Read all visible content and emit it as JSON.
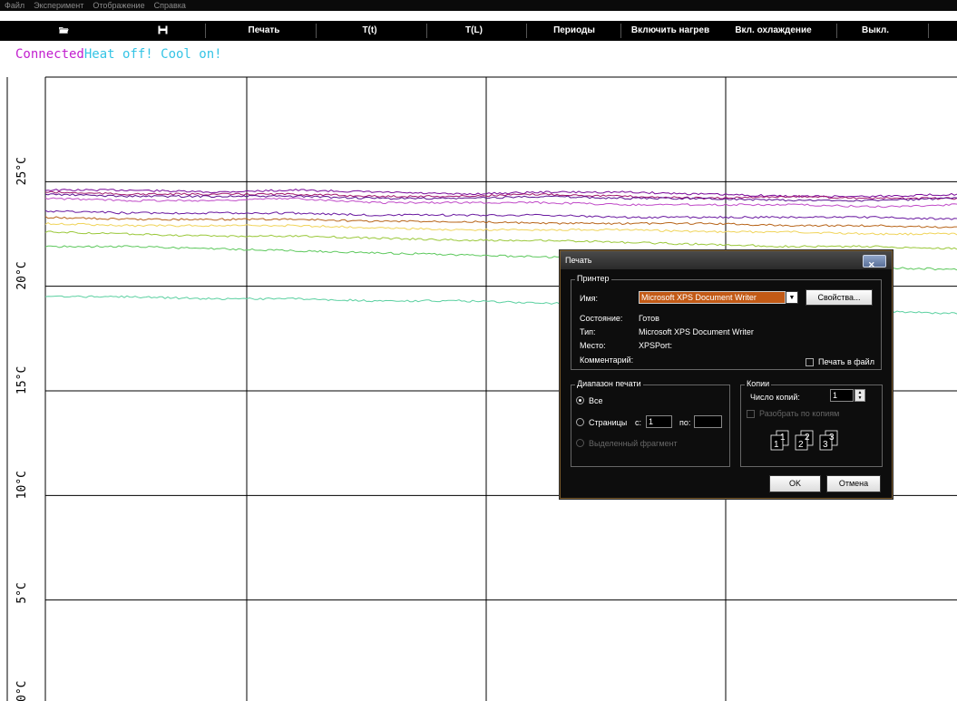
{
  "menu": [
    "Файл",
    "Эксперимент",
    "Отображение",
    "Справка"
  ],
  "toolbar": {
    "open_icon": "folder-open-icon",
    "save_icon": "floppy-save-icon",
    "print": "Печать",
    "t_time": "T(t)",
    "t_length": "T(L)",
    "periods": "Периоды",
    "heat_on": "Включить нагрев",
    "cool_on": "Вкл. охлаждение",
    "off": "Выкл."
  },
  "status": {
    "connected": "Connected",
    "heat_cool": "Heat off! Cool on!",
    "connected_color": "#c21fcf",
    "heat_color": "#35c4e5"
  },
  "chart_data": {
    "type": "line",
    "ylabels": [
      "25°C",
      "20°C",
      "15°C",
      "10°C",
      "5°C",
      "0°C"
    ],
    "y_ticks": [
      25,
      20,
      15,
      10,
      5,
      0
    ],
    "ylim": [
      0,
      30
    ],
    "grid": true,
    "series": [
      {
        "color": "#7a0a9a",
        "values": [
          24.6,
          24.6,
          24.5,
          24.6,
          24.5,
          24.4,
          24.5,
          24.5,
          24.4,
          24.3,
          24.3,
          24.4
        ]
      },
      {
        "color": "#a0186e",
        "values": [
          24.5,
          24.4,
          24.4,
          24.4,
          24.3,
          24.3,
          24.4,
          24.3,
          24.2,
          24.3,
          24.2,
          24.2
        ]
      },
      {
        "color": "#5a0f8f",
        "values": [
          24.4,
          24.3,
          24.3,
          24.3,
          24.2,
          24.2,
          24.3,
          24.2,
          24.2,
          24.1,
          24.1,
          24.2
        ]
      },
      {
        "color": "#c04bc8",
        "values": [
          24.2,
          24.1,
          24.1,
          24.2,
          24.0,
          24.0,
          24.0,
          23.9,
          23.9,
          23.9,
          23.8,
          23.9
        ]
      },
      {
        "color": "#6a1aa0",
        "values": [
          23.6,
          23.5,
          23.5,
          23.5,
          23.4,
          23.4,
          23.4,
          23.3,
          23.3,
          23.3,
          23.3,
          23.2
        ]
      },
      {
        "color": "#b8651a",
        "values": [
          23.3,
          23.2,
          23.2,
          23.2,
          23.1,
          23.1,
          23.0,
          23.0,
          23.0,
          22.9,
          22.9,
          22.8
        ]
      },
      {
        "color": "#f0d45a",
        "values": [
          23.0,
          22.9,
          22.9,
          22.9,
          22.8,
          22.7,
          22.7,
          22.7,
          22.6,
          22.6,
          22.5,
          22.5
        ]
      },
      {
        "color": "#9ac83a",
        "values": [
          22.6,
          22.5,
          22.4,
          22.4,
          22.3,
          22.2,
          22.2,
          22.1,
          22.0,
          21.9,
          21.9,
          21.8
        ]
      },
      {
        "color": "#5cc85c",
        "values": [
          21.9,
          21.9,
          21.8,
          21.7,
          21.6,
          21.5,
          21.4,
          21.3,
          21.2,
          21.1,
          20.9,
          20.8
        ]
      },
      {
        "color": "#5ad0a0",
        "values": [
          19.5,
          19.5,
          19.4,
          19.4,
          19.3,
          19.3,
          19.2,
          19.1,
          19.0,
          18.9,
          18.8,
          18.7
        ]
      }
    ]
  },
  "dialog": {
    "title": "Печать",
    "printer_group": "Принтер",
    "name_label": "Имя:",
    "name_value": "Microsoft XPS Document Writer",
    "properties_btn": "Свойства...",
    "state_label": "Состояние:",
    "state_value": "Готов",
    "type_label": "Тип:",
    "type_value": "Microsoft XPS Document Writer",
    "place_label": "Место:",
    "place_value": "XPSPort:",
    "comment_label": "Комментарий:",
    "print_to_file": "Печать в файл",
    "range_group": "Диапазон печати",
    "all": "Все",
    "pages": "Страницы",
    "from_label": "с:",
    "from_value": "1",
    "to_label": "по:",
    "to_value": "",
    "selection": "Выделенный фрагмент",
    "copies_group": "Копии",
    "copies_label": "Число копий:",
    "copies_value": "1",
    "collate": "Разобрать по копиям",
    "ok": "OK",
    "cancel": "Отмена"
  }
}
